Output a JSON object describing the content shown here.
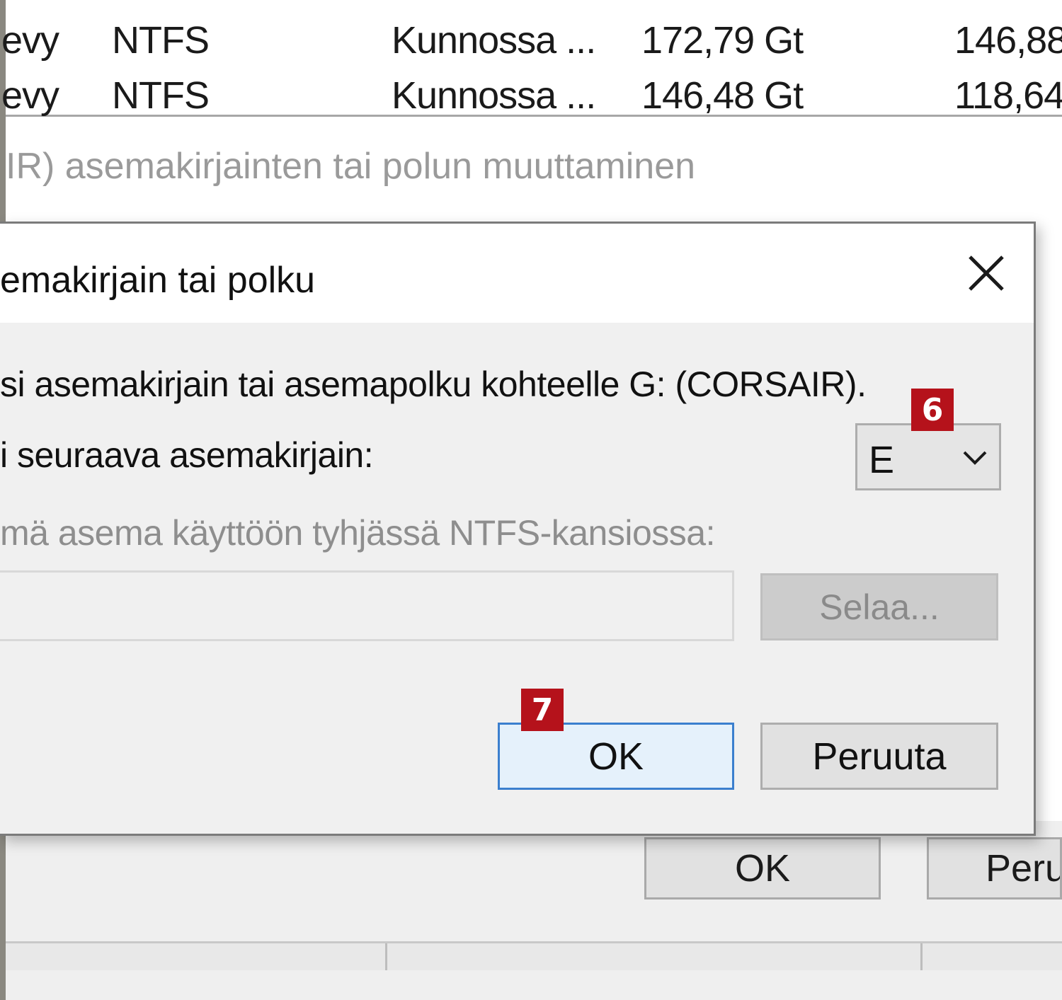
{
  "disk_list": {
    "rows": [
      {
        "type": "evy",
        "filesystem": "NTFS",
        "status": "Kunnossa ...",
        "capacity": "172,79 Gt",
        "free": "146,88"
      },
      {
        "type": "evy",
        "filesystem": "NTFS",
        "status": "Kunnossa ...",
        "capacity": "146,48 Gt",
        "free": "118,64"
      }
    ]
  },
  "background_window": {
    "instruction": "IR) asemakirjainten tai polun muuttaminen",
    "ok_label": "OK",
    "cancel_label": "Peru"
  },
  "dialog": {
    "title": "emakirjain tai polku",
    "description": "si asemakirjain tai asemapolku kohteelle G: (CORSAIR).",
    "assign_letter_label": "i seuraava asemakirjain:",
    "selected_letter": "E",
    "mount_folder_label": "mä asema käyttöön tyhjässä NTFS-kansiossa:",
    "path_value": "",
    "browse_label": "Selaa...",
    "ok_label": "OK",
    "cancel_label": "Peruuta"
  },
  "annotations": {
    "step_6": "6",
    "step_7": "7",
    "badge_color": "#b5121b"
  },
  "icons": {
    "close": "close-icon",
    "dropdown": "chevron-down-icon"
  }
}
